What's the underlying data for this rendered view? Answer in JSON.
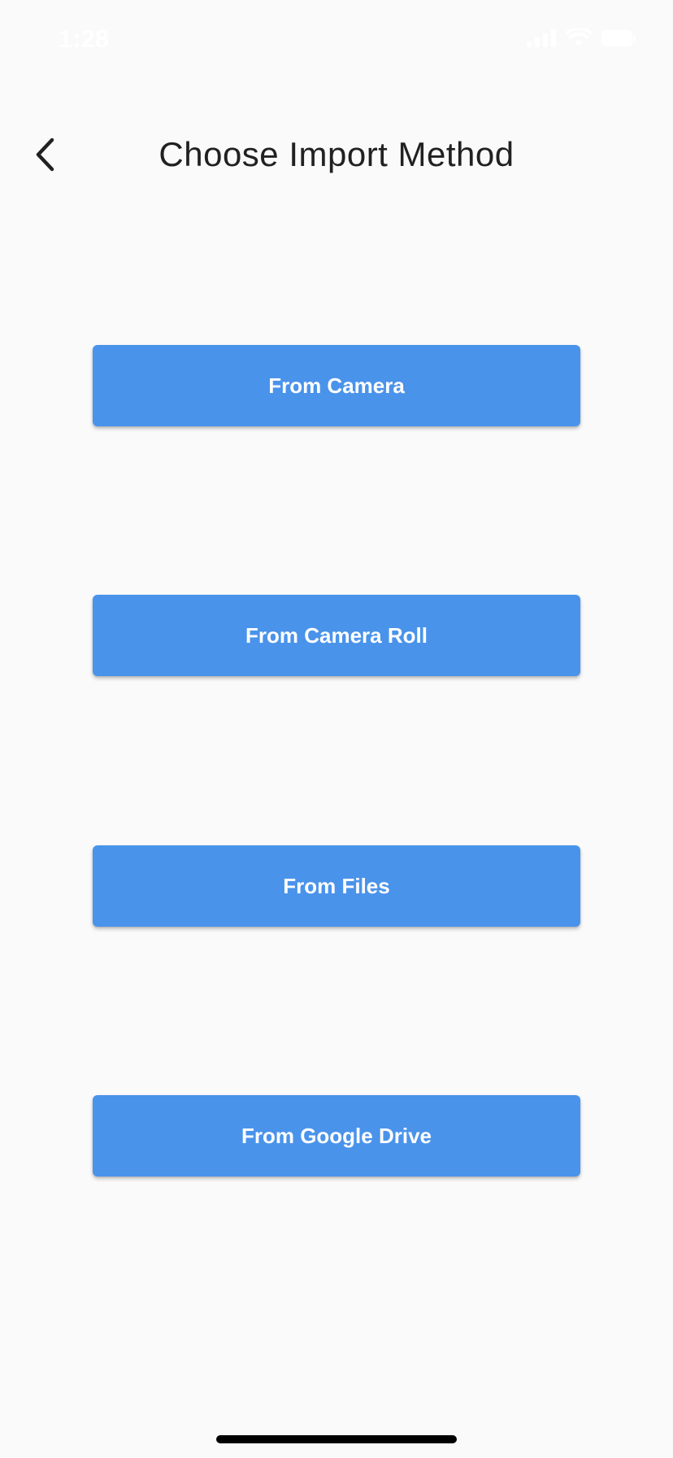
{
  "status_bar": {
    "time": "1:28",
    "icons": [
      "signal-icon",
      "wifi-icon",
      "battery-icon"
    ]
  },
  "nav": {
    "back_icon": "chevron-left-icon",
    "title": "Choose Import Method"
  },
  "buttons": {
    "camera": "From Camera",
    "camera_roll": "From Camera Roll",
    "files": "From Files",
    "google_drive": "From Google Drive"
  },
  "colors": {
    "background": "#fafafa",
    "button": "#4a93eb",
    "button_text": "#ffffff",
    "title_text": "#212121"
  }
}
